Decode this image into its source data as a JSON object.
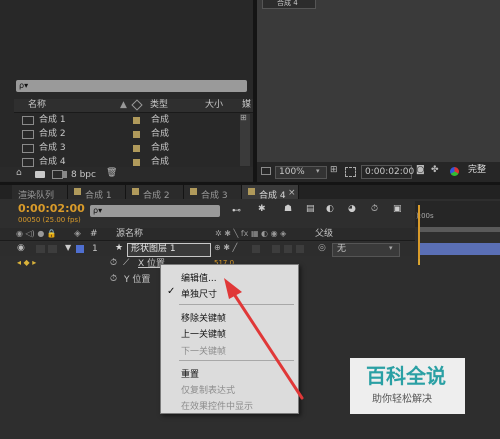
{
  "project": {
    "search_placeholder": "ρ▾",
    "headers": {
      "name": "名称",
      "type": "类型",
      "size": "大小",
      "media": "媒"
    },
    "items": [
      {
        "name": "合成 1",
        "type": "合成"
      },
      {
        "name": "合成 2",
        "type": "合成"
      },
      {
        "name": "合成 3",
        "type": "合成"
      },
      {
        "name": "合成 4",
        "type": "合成"
      }
    ],
    "bpc": "8 bpc"
  },
  "viewer": {
    "top_tab": "合成 4",
    "zoom": "100%",
    "timecode": "0:00:02:00",
    "quality": "完整"
  },
  "tabs": [
    "渲染队列",
    "合成 1",
    "合成 2",
    "合成 3",
    "合成 4"
  ],
  "timeline": {
    "current_time": "0:00:02:00",
    "frame_info": "00050 (25.00 fps)",
    "search_placeholder": "ρ▾",
    "ruler_label": "):00s",
    "columns": {
      "hash": "#",
      "source_name": "源名称",
      "parent": "父级"
    },
    "layer": {
      "number": "1",
      "name": "形状图层 1",
      "parent_value": "无"
    },
    "props": {
      "x_position": "X 位置",
      "y_position": "Y 位置",
      "x_value": "517.0"
    }
  },
  "context_menu": {
    "items": [
      {
        "label": "编辑值...",
        "enabled": true,
        "checked": false
      },
      {
        "label": "单独尺寸",
        "enabled": true,
        "checked": true
      },
      {
        "label": "移除关键帧",
        "enabled": true,
        "checked": false
      },
      {
        "label": "上一关键帧",
        "enabled": true,
        "checked": false
      },
      {
        "label": "下一关键帧",
        "enabled": false,
        "checked": false
      },
      {
        "label": "重置",
        "enabled": true,
        "checked": false
      },
      {
        "label": "仅复制表达式",
        "enabled": false,
        "checked": false
      },
      {
        "label": "在效果控件中显示",
        "enabled": false,
        "checked": false
      }
    ],
    "check_mark": "✓"
  },
  "watermark": {
    "title": "百科全说",
    "subtitle": "助你轻松解决"
  },
  "colors": {
    "accent_time": "#d99b2a",
    "arrow": "#e03838",
    "layer_bar": "#5a6fb5",
    "label_blue": "#4f6fd0"
  }
}
